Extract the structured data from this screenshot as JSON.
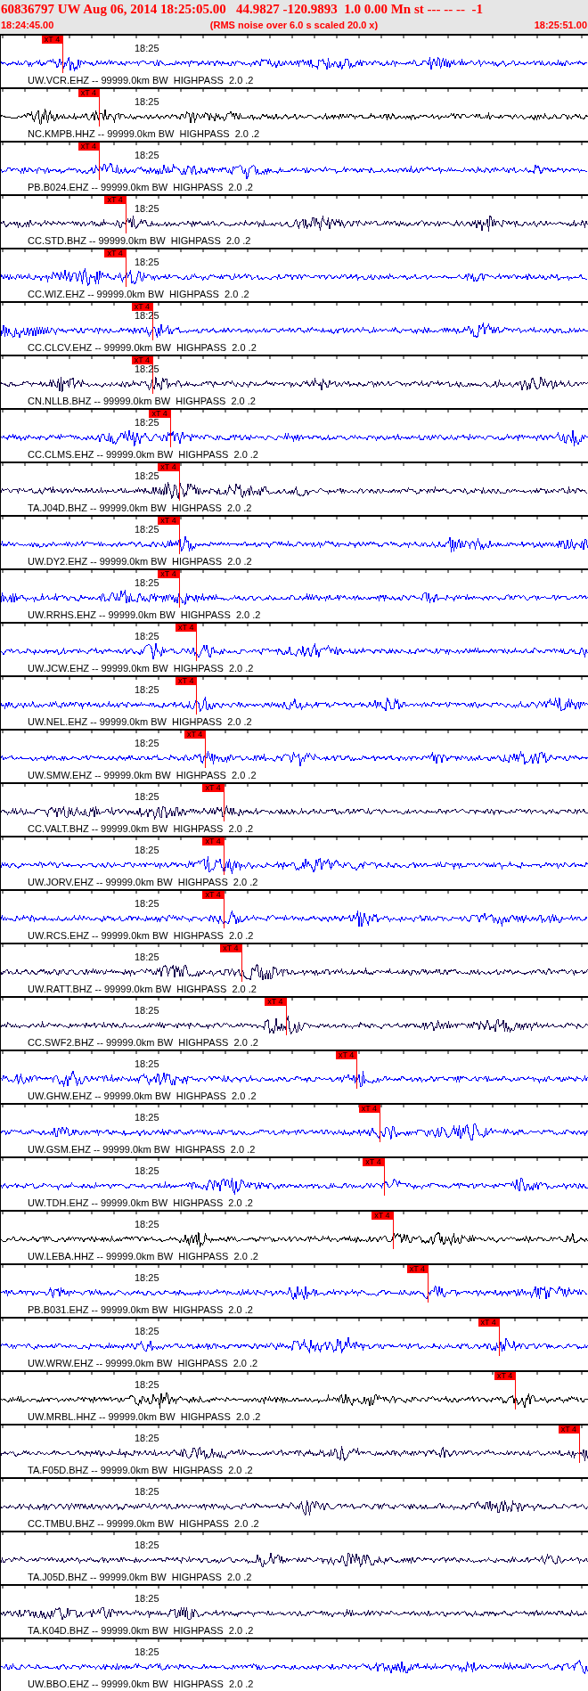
{
  "header": {
    "title": "60836797 UW Aug 06, 2014 18:25:05.00   44.9827 -120.9893  1.0 0.00 Mn st --- -- --  -1",
    "start_time": "18:24:45.00",
    "note": "(RMS noise over 6.0 s scaled 20.0 x)",
    "end_time": "18:25:51.00"
  },
  "traces": [
    {
      "label": "UW.VCR.EHZ -- 99999.0km BW  HIGHPASS  2.0 .2",
      "time_mark": "18:25",
      "pick": {
        "text": "xT 4",
        "level": 0.105
      },
      "color": "#0000ff"
    },
    {
      "label": "NC.KMPB.HHZ -- 99999.0km BW  HIGHPASS  2.0 .2",
      "time_mark": "18:25",
      "pick": {
        "text": "xT 4",
        "level": 0.167
      },
      "color": "#000000"
    },
    {
      "label": "PB.B024.EHZ -- 99999.0km BW  HIGHPASS  2.0 .2",
      "time_mark": "18:25",
      "pick": {
        "text": "xT 4",
        "level": 0.167
      },
      "color": "#0000ff"
    },
    {
      "label": "CC.STD.BHZ -- 99999.0km BW  HIGHPASS  2.0 .2",
      "time_mark": "18:25",
      "pick": {
        "text": "xT 4",
        "level": 0.212
      },
      "color": "#1a0a50"
    },
    {
      "label": "CC.WIZ.EHZ -- 99999.0km BW  HIGHPASS  2.0 .2",
      "time_mark": "18:25",
      "pick": {
        "text": "xT 4",
        "level": 0.212
      },
      "color": "#0000ff"
    },
    {
      "label": "CC.CLCV.EHZ -- 99999.0km BW  HIGHPASS  2.0 .2",
      "time_mark": "18:25",
      "pick": {
        "text": "xT 4",
        "level": 0.258
      },
      "color": "#0000ff"
    },
    {
      "label": "CN.NLLB.BHZ -- 99999.0km BW  HIGHPASS  2.0 .2",
      "time_mark": "18:25",
      "pick": {
        "text": "xT 4",
        "level": 0.258
      },
      "color": "#1a0a50"
    },
    {
      "label": "CC.CLMS.EHZ -- 99999.0km BW  HIGHPASS  2.0 .2",
      "time_mark": "18:25",
      "pick": {
        "text": "xT 4",
        "level": 0.288
      },
      "color": "#0000ff"
    },
    {
      "label": "TA.J04D.BHZ -- 99999.0km BW  HIGHPASS  2.0 .2",
      "time_mark": "18:25",
      "pick": {
        "text": "xT 4",
        "level": 0.303
      },
      "color": "#1a0a50"
    },
    {
      "label": "UW.DY2.EHZ -- 99999.0km BW  HIGHPASS  2.0 .2",
      "time_mark": "18:25",
      "pick": {
        "text": "xT 4",
        "level": 0.303
      },
      "color": "#0000ff"
    },
    {
      "label": "UW.RRHS.EHZ -- 99999.0km BW  HIGHPASS  2.0 .2",
      "time_mark": "18:25",
      "pick": {
        "text": "xT 4",
        "level": 0.303
      },
      "color": "#0000ff"
    },
    {
      "label": "UW.JCW.EHZ -- 99999.0km BW  HIGHPASS  2.0 .2",
      "time_mark": "18:25",
      "pick": {
        "text": "xT 4",
        "level": 0.333
      },
      "color": "#0000ff"
    },
    {
      "label": "UW.NEL.EHZ -- 99999.0km BW  HIGHPASS  2.0 .2",
      "time_mark": "18:25",
      "pick": {
        "text": "xT 4",
        "level": 0.333
      },
      "color": "#0000ff"
    },
    {
      "label": "UW.SMW.EHZ -- 99999.0km BW  HIGHPASS  2.0 .2",
      "time_mark": "18:25",
      "pick": {
        "text": "xT 4",
        "level": 0.348
      },
      "color": "#0000ff"
    },
    {
      "label": "CC.VALT.BHZ -- 99999.0km BW  HIGHPASS  2.0 .2",
      "time_mark": "18:25",
      "pick": {
        "text": "xT 4",
        "level": 0.379
      },
      "color": "#1a0a50"
    },
    {
      "label": "UW.JORV.EHZ -- 99999.0km BW  HIGHPASS  2.0 .2",
      "time_mark": "18:25",
      "pick": {
        "text": "xT 4",
        "level": 0.379
      },
      "color": "#0000ff"
    },
    {
      "label": "UW.RCS.EHZ -- 99999.0km BW  HIGHPASS  2.0 .2",
      "time_mark": "18:25",
      "pick": {
        "text": "xT 4",
        "level": 0.379
      },
      "color": "#0000ff"
    },
    {
      "label": "UW.RATT.BHZ -- 99999.0km BW  HIGHPASS  2.0 .2",
      "time_mark": "18:25",
      "pick": {
        "text": "xT 4",
        "level": 0.409
      },
      "color": "#1a0a50"
    },
    {
      "label": "CC.SWF2.BHZ -- 99999.0km BW  HIGHPASS  2.0 .2",
      "time_mark": "18:25",
      "pick": {
        "text": "xT 4",
        "level": 0.485
      },
      "color": "#1a0a50"
    },
    {
      "label": "UW.GHW.EHZ -- 99999.0km BW  HIGHPASS  2.0 .2",
      "time_mark": "18:25",
      "pick": {
        "text": "xT 4",
        "level": 0.606
      },
      "color": "#0000ff"
    },
    {
      "label": "UW.GSM.EHZ -- 99999.0km BW  HIGHPASS  2.0 .2",
      "time_mark": "18:25",
      "pick": {
        "text": "xT 4",
        "level": 0.645
      },
      "color": "#0000ff"
    },
    {
      "label": "UW.TDH.EHZ -- 99999.0km BW  HIGHPASS  2.0 .2",
      "time_mark": "18:25",
      "pick": {
        "text": "xT 4",
        "level": 0.652
      },
      "color": "#0000ff"
    },
    {
      "label": "UW.LEBA.HHZ -- 99999.0km BW  HIGHPASS  2.0 .2",
      "time_mark": "18:25",
      "pick": {
        "text": "xT 4",
        "level": 0.667
      },
      "color": "#000000"
    },
    {
      "label": "PB.B031.EHZ -- 99999.0km BW  HIGHPASS  2.0 .2",
      "time_mark": "18:25",
      "pick": {
        "text": "xT 4",
        "level": 0.727
      },
      "color": "#0000ff"
    },
    {
      "label": "UW.WRW.EHZ -- 99999.0km BW  HIGHPASS  2.0 .2",
      "time_mark": "18:25",
      "pick": {
        "text": "xT 4",
        "level": 0.848
      },
      "color": "#0000ff"
    },
    {
      "label": "UW.MRBL.HHZ -- 99999.0km BW  HIGHPASS  2.0 .2",
      "time_mark": "18:25",
      "pick": {
        "text": "xT 4",
        "level": 0.876
      },
      "color": "#000000"
    },
    {
      "label": "TA.F05D.BHZ -- 99999.0km BW  HIGHPASS  2.0 .2",
      "time_mark": "18:25",
      "pick": {
        "text": "xT 4",
        "level": 0.985
      },
      "color": "#1a0a50"
    },
    {
      "label": "CC.TMBU.BHZ -- 99999.0km BW  HIGHPASS  2.0 .2",
      "time_mark": "18:25",
      "color": "#1a0a50"
    },
    {
      "label": "TA.J05D.BHZ -- 99999.0km BW  HIGHPASS  2.0 .2",
      "time_mark": "18:25",
      "color": "#1a0a50"
    },
    {
      "label": "TA.K04D.BHZ -- 99999.0km BW  HIGHPASS  2.0 .2",
      "time_mark": "18:25",
      "color": "#1a0a50"
    },
    {
      "label": "UW.BBO.EHZ -- 99999.0km BW  HIGHPASS  2.0 .2",
      "time_mark": "18:25",
      "color": "#0000ff"
    }
  ]
}
